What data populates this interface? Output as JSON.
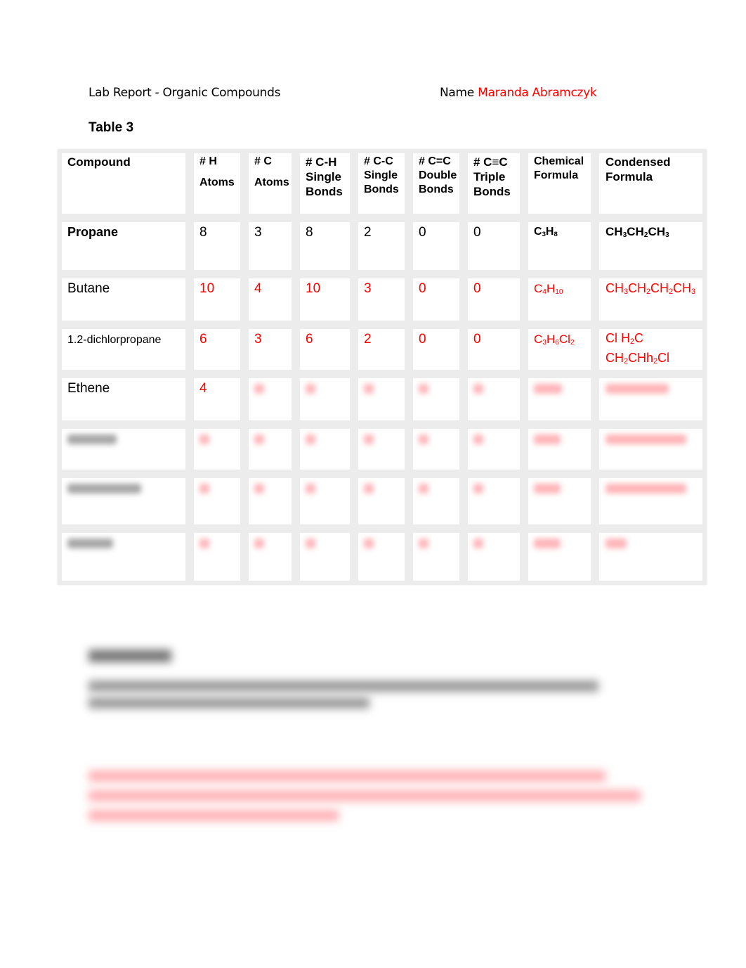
{
  "header": {
    "title": "Lab Report - Organic Compounds",
    "name_label": "Name",
    "name_value": "Maranda Abramczyk"
  },
  "table_title": "Table 3",
  "table": {
    "columns": [
      [
        "Compound"
      ],
      [
        "# H",
        "Atoms"
      ],
      [
        "# C",
        "Atoms"
      ],
      [
        "# C-H",
        "Single",
        "Bonds"
      ],
      [
        "# C-C",
        "Single",
        "Bonds"
      ],
      [
        "# C=C",
        "Double",
        "Bonds"
      ],
      [
        "# C≡C",
        "Triple",
        "Bonds"
      ],
      [
        "Chemical",
        "Formula"
      ],
      [
        "Condensed",
        "Formula"
      ]
    ],
    "rows": [
      {
        "compound": "Propane",
        "h": "8",
        "c": "3",
        "ch": "8",
        "cc": "2",
        "cdc": "0",
        "ctc": "0",
        "formula": [
          [
            "C",
            "3"
          ],
          [
            "H",
            "8"
          ]
        ],
        "condensed": [
          [
            "CH",
            "3"
          ],
          [
            "CH",
            "2"
          ],
          [
            "CH",
            "3"
          ]
        ]
      },
      {
        "compound": "Butane",
        "h": "10",
        "c": "4",
        "ch": "10",
        "cc": "3",
        "cdc": "0",
        "ctc": "0",
        "formula": [
          [
            "C",
            "4"
          ],
          [
            "H",
            "10"
          ]
        ],
        "condensed": [
          [
            "CH",
            "3"
          ],
          [
            "CH",
            "2"
          ],
          [
            "CH",
            "2"
          ],
          [
            "CH",
            "3"
          ]
        ]
      },
      {
        "compound": "1.2-dichlorpropane",
        "h": "6",
        "c": "3",
        "ch": "6",
        "cc": "2",
        "cdc": "0",
        "ctc": "0",
        "formula": [
          [
            "C",
            "3"
          ],
          [
            "H",
            "6"
          ],
          [
            "Cl",
            "2"
          ]
        ],
        "condensed_lines": [
          [
            [
              "Cl H",
              "2"
            ],
            [
              "C",
              ""
            ]
          ],
          [
            [
              "CH",
              "2"
            ],
            [
              "CHh",
              "2"
            ],
            [
              "Cl",
              ""
            ]
          ]
        ]
      },
      {
        "compound": "Ethene",
        "h": "4"
      }
    ],
    "obscured_rows": 3
  },
  "colors": {
    "answer": "#ff0000",
    "text": "#000000",
    "grid": "#ececec"
  }
}
